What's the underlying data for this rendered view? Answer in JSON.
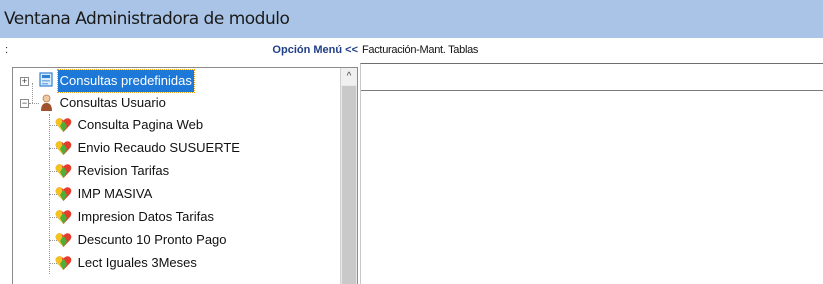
{
  "window": {
    "title": "Ventana Administradora de modulo"
  },
  "subbar": {
    "colon": ":",
    "menu_option": "Opción Menú <<",
    "module_path": "Facturación-Mant. Tablas"
  },
  "tree": {
    "items": [
      {
        "label": "Consultas predefinidas",
        "icon": "predefined-queries-icon",
        "expander": "+",
        "selected": true
      },
      {
        "label": "Consultas Usuario",
        "icon": "user-person-icon",
        "expander": "−",
        "selected": false
      },
      {
        "label": "Consulta Pagina Web",
        "icon": "query-heart-icon",
        "selected": false
      },
      {
        "label": "Envio Recaudo SUSUERTE",
        "icon": "query-heart-icon",
        "selected": false
      },
      {
        "label": "Revision Tarifas",
        "icon": "query-heart-icon",
        "selected": false
      },
      {
        "label": "IMP MASIVA",
        "icon": "query-heart-icon",
        "selected": false
      },
      {
        "label": "Impresion Datos Tarifas",
        "icon": "query-heart-icon",
        "selected": false
      },
      {
        "label": "Descunto 10 Pronto Pago",
        "icon": "query-heart-icon",
        "selected": false
      },
      {
        "label": "Lect Iguales 3Meses",
        "icon": "query-heart-icon",
        "selected": false
      }
    ]
  },
  "scrollbar": {
    "up_arrow": "^"
  }
}
